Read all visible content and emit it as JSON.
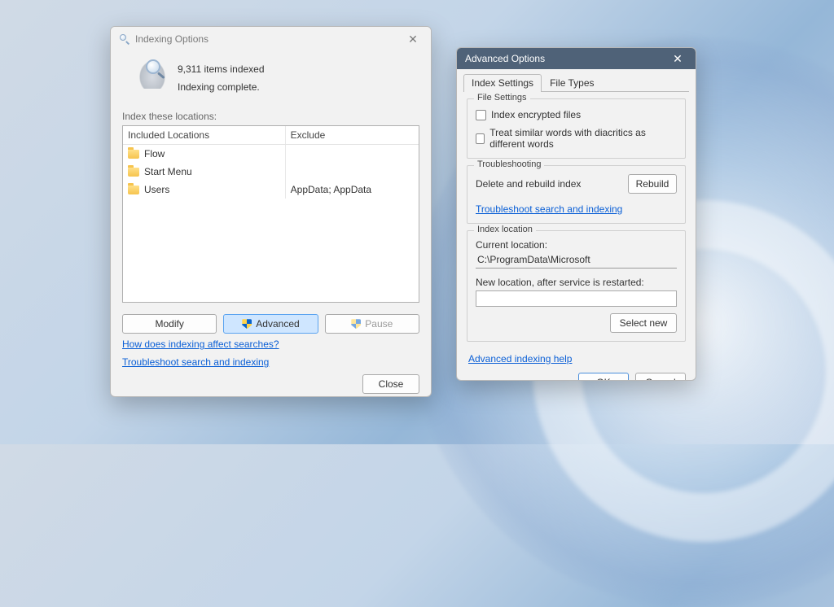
{
  "indexing": {
    "title": "Indexing Options",
    "items_indexed": "9,311 items indexed",
    "status": "Indexing complete.",
    "locations_label": "Index these locations:",
    "columns": {
      "included": "Included Locations",
      "exclude": "Exclude"
    },
    "rows": [
      {
        "name": "Flow",
        "exclude": ""
      },
      {
        "name": "Start Menu",
        "exclude": ""
      },
      {
        "name": "Users",
        "exclude": "AppData; AppData"
      }
    ],
    "buttons": {
      "modify": "Modify",
      "advanced": "Advanced",
      "pause": "Pause",
      "close": "Close"
    },
    "links": {
      "how": "How does indexing affect searches?",
      "troubleshoot": "Troubleshoot search and indexing"
    }
  },
  "advanced": {
    "title": "Advanced Options",
    "tabs": {
      "index_settings": "Index Settings",
      "file_types": "File Types"
    },
    "file_settings": {
      "legend": "File Settings",
      "encrypt": "Index encrypted files",
      "diacritics": "Treat similar words with diacritics as different words"
    },
    "troubleshooting": {
      "legend": "Troubleshooting",
      "delete_label": "Delete and rebuild index",
      "rebuild": "Rebuild",
      "link": "Troubleshoot search and indexing"
    },
    "index_location": {
      "legend": "Index location",
      "current_label": "Current location:",
      "current_value": "C:\\ProgramData\\Microsoft",
      "new_label": "New location, after service is restarted:",
      "new_value": "",
      "select_new": "Select new"
    },
    "help_link": "Advanced indexing help",
    "buttons": {
      "ok": "OK",
      "cancel": "Cancel"
    }
  }
}
